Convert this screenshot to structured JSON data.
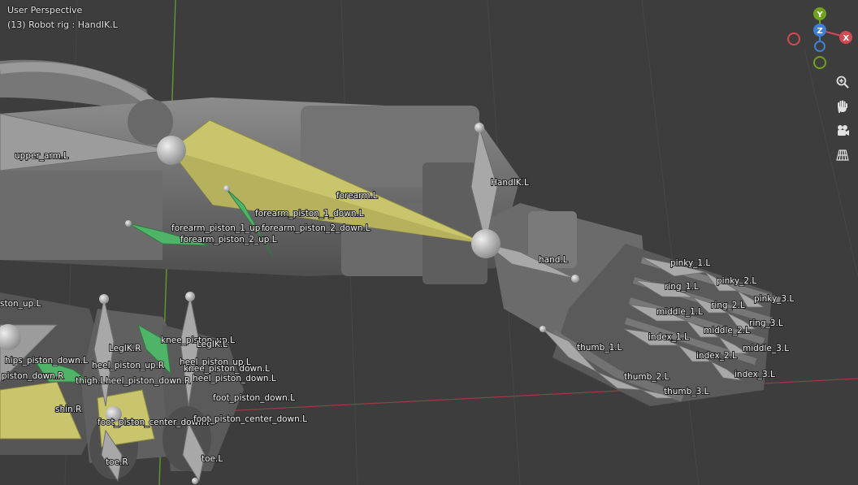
{
  "header": {
    "view_name": "User Perspective",
    "object_info": "(13) Robot rig : HandIK.L"
  },
  "gizmo": {
    "y_label": "Y",
    "z_label": "Z",
    "x_label": "X",
    "x_color": "#d44a52",
    "y_color": "#6fa21f",
    "z_color": "#3f7fd6"
  },
  "toolbar": {
    "zoom_icon": "zoom-in-icon",
    "pan_icon": "hand-icon",
    "camera_icon": "camera-icon",
    "ortho_icon": "grid-perspective-icon"
  },
  "colors": {
    "background": "#3d3d3d",
    "bone_gray": "#a8a8a8",
    "bone_selected": "#c9c56c",
    "bone_green": "#4fb368",
    "grid_x_axis": "#9b3b45",
    "grid_y_axis": "#5f9a2f"
  },
  "bones": {
    "upper_arm_L": "upper_arm.L",
    "forearm_L": "forearm.L",
    "HandIK_L": "HandIK.L",
    "hand_L": "hand.L",
    "forearm_piston_1_down_L": "forearm_piston_1_down.L",
    "forearm_piston_1_up_L": "forearm_piston_1_up.L",
    "forearm_piston_2_down_L": "forearm_piston_2_down.L",
    "forearm_piston_2_up_L": "forearm_piston_2_up.L",
    "pinky_1_L": "pinky_1.L",
    "pinky_2_L": "pinky_2.L",
    "pinky_3_L": "pinky_3.L",
    "ring_1_L": "ring_1.L",
    "ring_2_L": "ring_2.L",
    "ring_3_L": "ring_3.L",
    "middle_1_L": "middle_1.L",
    "middle_2_L": "middle_2.L",
    "middle_3_L": "middle_3.L",
    "index_1_L": "index_1.L",
    "index_2_L": "index_2.L",
    "index_3_L": "index_3.L",
    "thumb_1_L": "thumb_1.L",
    "thumb_2_L": "thumb_2.L",
    "thumb_3_L": "thumb_3.L",
    "piston_up_L": "ston_up.L",
    "hips_piston_down_L": "hips_piston_down.L",
    "piston_down_R": "piston_down.R",
    "LegIK_R": "LegIK.R",
    "heel_piston_up_R": "heel_piston_up.R",
    "thigh_L": "thigh.L",
    "heel_piston_down_R": "heel_piston_down.R",
    "knee_piston_up_L": "knee_piston_up.L",
    "LegIK_L": "LegIK.L",
    "heel_piston_up_L": "heel_piston_up.L",
    "knee_piston_down_L": "knee_piston_down.L",
    "heel_piston_down_L": "heel_piston_down.L",
    "shin_R": "shin.R",
    "foot_piston_down_L": "foot_piston_down.L",
    "foot_piston_center_down_R": "foot_piston_center_down.R",
    "foot_piston_center_down_L": "foot_piston_center_down.L",
    "toe_R": "toe.R",
    "toe_L": "toe.L"
  }
}
